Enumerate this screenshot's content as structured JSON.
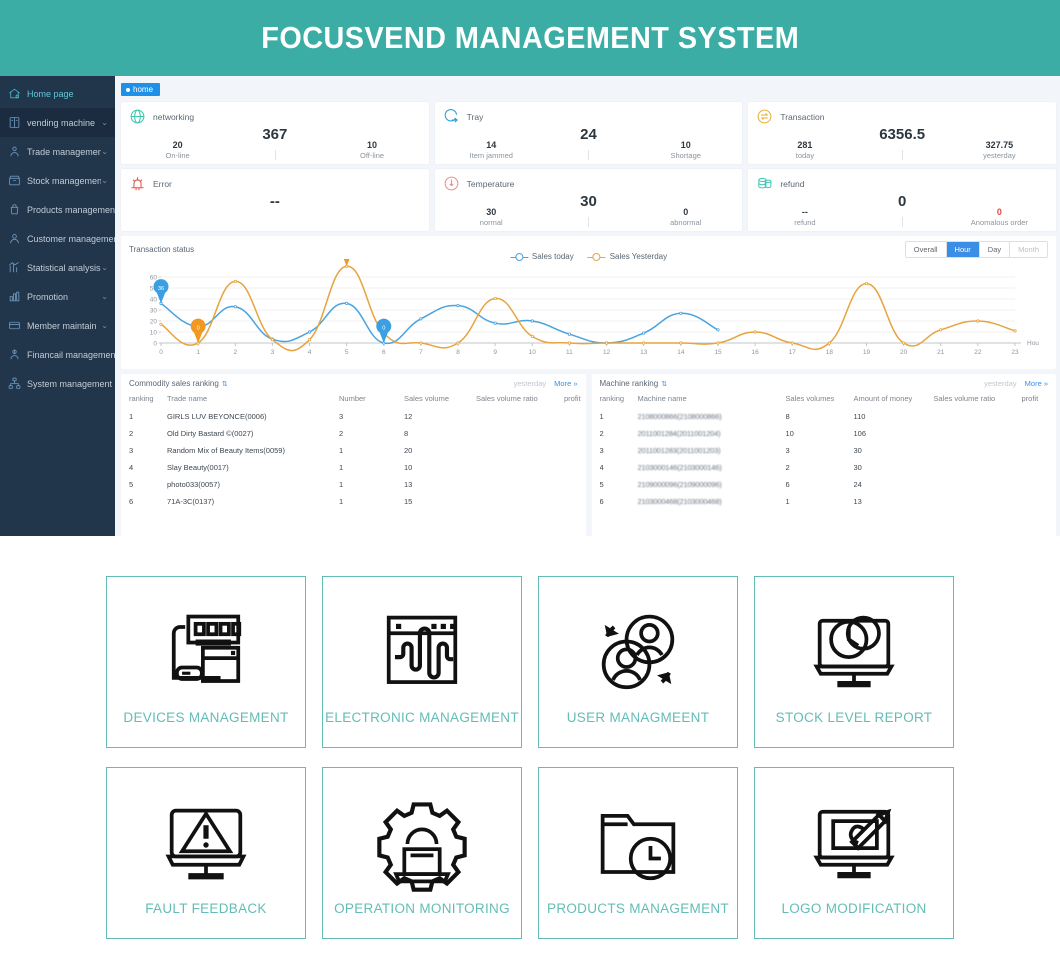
{
  "header": {
    "title": "FOCUSVEND MANAGEMENT SYSTEM",
    "bg": "#3bada4"
  },
  "sidebar": {
    "items": [
      {
        "label": "Home page",
        "icon": "home-icon",
        "caret": "",
        "active": true
      },
      {
        "label": "vending machine",
        "icon": "machine-icon",
        "caret": "⌄"
      },
      {
        "label": "Trade management",
        "icon": "trade-icon",
        "caret": "⌄"
      },
      {
        "label": "Stock management",
        "icon": "stock-icon",
        "caret": "⌄"
      },
      {
        "label": "Products management",
        "icon": "products-icon",
        "caret": ""
      },
      {
        "label": "Customer management",
        "icon": "customer-icon",
        "caret": ""
      },
      {
        "label": "Statistical analysis",
        "icon": "stats-icon",
        "caret": "⌄"
      },
      {
        "label": "Promotion",
        "icon": "promotion-icon",
        "caret": "⌄"
      },
      {
        "label": "Member maintain",
        "icon": "member-icon",
        "caret": "⌄"
      },
      {
        "label": "Financail management",
        "icon": "finance-icon",
        "caret": ""
      },
      {
        "label": "System management",
        "icon": "system-icon",
        "caret": ""
      }
    ]
  },
  "tab": {
    "label": "home"
  },
  "cards": [
    {
      "title": "networking",
      "icon": "globe-icon",
      "icon_color": "#3ec6b0",
      "center": "367",
      "left": {
        "value": "20",
        "label": "On-line"
      },
      "right": {
        "value": "10",
        "label": "Off-line"
      }
    },
    {
      "title": "Tray",
      "icon": "tray-icon",
      "icon_color": "#2f9fd4",
      "center": "24",
      "left": {
        "value": "14",
        "label": "Item jammed"
      },
      "right": {
        "value": "10",
        "label": "Shortage"
      }
    },
    {
      "title": "Transaction",
      "icon": "transaction-icon",
      "icon_color": "#e6b33c",
      "center": "6356.5",
      "left": {
        "value": "281",
        "label": "today"
      },
      "right": {
        "value": "327.75",
        "label": "yesterday"
      }
    },
    {
      "title": "Error",
      "icon": "alarm-icon",
      "icon_color": "#e8534a",
      "center": "--",
      "left": {
        "value": "",
        "label": ""
      },
      "right": {
        "value": "",
        "label": ""
      }
    },
    {
      "title": "Temperature",
      "icon": "thermometer-icon",
      "icon_color": "#ef8f8a",
      "center": "30",
      "left": {
        "value": "30",
        "label": "normal"
      },
      "right": {
        "value": "0",
        "label": "abnormal"
      }
    },
    {
      "title": "refund",
      "icon": "refund-icon",
      "icon_color": "#3ec6b0",
      "center": "0",
      "left": {
        "value": "--",
        "label": "refund"
      },
      "right": {
        "value": "0",
        "label": "Anomalous order",
        "accent": "#e8453c"
      }
    }
  ],
  "chart_panel": {
    "title": "Transaction status",
    "segments": [
      {
        "label": "Overall",
        "state": "normal"
      },
      {
        "label": "Hour",
        "state": "active"
      },
      {
        "label": "Day",
        "state": "normal"
      },
      {
        "label": "Month",
        "state": "disabled"
      }
    ]
  },
  "chart_data": {
    "type": "line",
    "title": "Transaction status",
    "xlabel": "Hou",
    "ylabel": "",
    "grid": true,
    "legend_position": "top-center",
    "xlim": [
      0,
      23
    ],
    "ylim": [
      0,
      60
    ],
    "yticks": [
      0,
      10,
      20,
      30,
      40,
      50,
      60
    ],
    "categories": [
      "0",
      "1",
      "2",
      "3",
      "4",
      "5",
      "6",
      "7",
      "8",
      "9",
      "10",
      "11",
      "12",
      "13",
      "14",
      "15",
      "16",
      "17",
      "18",
      "19",
      "20",
      "21",
      "22",
      "23"
    ],
    "series": [
      {
        "name": "Sales today",
        "color": "#4aa3df",
        "values": [
          36,
          15,
          33,
          3.5,
          10,
          36,
          0,
          22,
          34,
          18,
          20,
          8,
          0,
          9,
          27,
          12,
          null,
          null,
          null,
          null,
          null,
          null,
          null,
          null
        ]
      },
      {
        "name": "Sales Yesterday",
        "color": "#e8a33d",
        "values": [
          17,
          0,
          56,
          3,
          3,
          69.75,
          9,
          0,
          0,
          40.5,
          6,
          0,
          0,
          0,
          0,
          0,
          10,
          0,
          0,
          54,
          0,
          12,
          20,
          11
        ]
      }
    ],
    "annotations": [
      {
        "series": "Sales today",
        "x": 0,
        "value": "36",
        "color": "#3aa0e3"
      },
      {
        "series": "Sales Yesterday",
        "x": 1,
        "value": "0",
        "color": "#f0981f"
      },
      {
        "series": "Sales Yesterday",
        "x": 5,
        "value": "69.75",
        "color": "#f0981f"
      },
      {
        "series": "Sales today",
        "x": 6,
        "value": "0",
        "color": "#3aa0e3"
      }
    ]
  },
  "commodity_table": {
    "title": "Commodity sales ranking",
    "period": "yesterday",
    "more": "More »",
    "columns": [
      "ranking",
      "Trade name",
      "Number",
      "Sales volume",
      "Sales volume ratio",
      "profit"
    ],
    "rows": [
      [
        "1",
        "GIRLS LUV BEYONCE(0006)",
        "3",
        "12",
        "",
        ""
      ],
      [
        "2",
        "Old Dirty Bastard ©(0027)",
        "2",
        "8",
        "",
        ""
      ],
      [
        "3",
        "Random Mix of Beauty Items(0059)",
        "1",
        "20",
        "",
        ""
      ],
      [
        "4",
        "Slay Beauty(0017)",
        "1",
        "10",
        "",
        ""
      ],
      [
        "5",
        "photo033(0057)",
        "1",
        "13",
        "",
        ""
      ],
      [
        "6",
        "71A-3C(0137)",
        "1",
        "15",
        "",
        ""
      ]
    ]
  },
  "machine_table": {
    "title": "Machine ranking",
    "period": "yesterday",
    "more": "More »",
    "columns": [
      "ranking",
      "Machine name",
      "Sales volumes",
      "Amount of money",
      "Sales volume ratio",
      "profit"
    ],
    "rows": [
      [
        "1",
        "2108000866(2108000866)",
        "8",
        "110",
        "",
        ""
      ],
      [
        "2",
        "2011001284(2011001204)",
        "10",
        "106",
        "",
        ""
      ],
      [
        "3",
        "2011001283(2011001203)",
        "3",
        "30",
        "",
        ""
      ],
      [
        "4",
        "2103000146(2103000146)",
        "2",
        "30",
        "",
        ""
      ],
      [
        "5",
        "2109000096(2109000096)",
        "6",
        "24",
        "",
        ""
      ],
      [
        "6",
        "2103000468(2103000468)",
        "1",
        "13",
        "",
        ""
      ]
    ]
  },
  "tiles": [
    {
      "label": "DEVICES MANAGEMENT",
      "icon": "devices-icon"
    },
    {
      "label": "ELECTRONIC MANAGEMENT",
      "icon": "waveform-window-icon"
    },
    {
      "label": "USER MANAGMEENT",
      "icon": "users-sync-icon"
    },
    {
      "label": "STOCK LEVEL REPORT",
      "icon": "monitor-chart-icon"
    },
    {
      "label": "FAULT FEEDBACK",
      "icon": "monitor-warning-icon"
    },
    {
      "label": "OPERATION MONITORING",
      "icon": "gear-laptop-icon"
    },
    {
      "label": "PRODUCTS MANAGEMENT",
      "icon": "folder-clock-icon"
    },
    {
      "label": "LOGO MODIFICATION",
      "icon": "monitor-brush-icon"
    }
  ],
  "theme": {
    "accent": "#63bdb6",
    "primary": "#3a8ee6",
    "sidebar_bg": "#21354b"
  }
}
